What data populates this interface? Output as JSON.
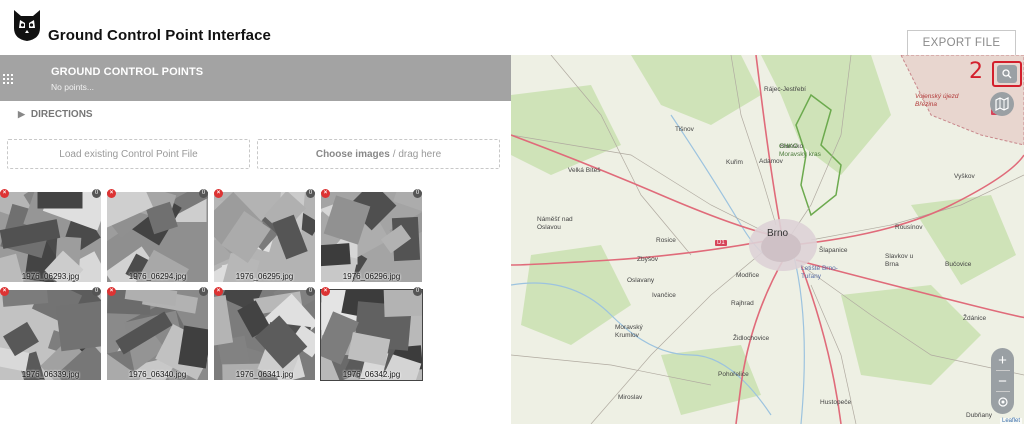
{
  "header": {
    "title": "Ground Control Point Interface",
    "export_label": "EXPORT FILE"
  },
  "gcp_panel": {
    "title": "GROUND CONTROL POINTS",
    "subtitle": "No points..."
  },
  "directions": {
    "label": "DIRECTIONS"
  },
  "actions": {
    "load_label": "Load existing Control Point File",
    "choose_bold": "Choose images",
    "choose_rest": "/ drag here"
  },
  "images": [
    {
      "name": "1976_06293.jpg",
      "points": "0",
      "tone": "#9a9a9a"
    },
    {
      "name": "1976_06294.jpg",
      "points": "0",
      "tone": "#8f8f8f"
    },
    {
      "name": "1976_06295.jpg",
      "points": "0",
      "tone": "#b3b3b3"
    },
    {
      "name": "1976_06296.jpg",
      "points": "0",
      "tone": "#a4a4a4"
    },
    {
      "name": "1976_06339.jpg",
      "points": "0",
      "tone": "#c2c2c2"
    },
    {
      "name": "1976_06340.jpg",
      "points": "0",
      "tone": "#8a8a8a"
    },
    {
      "name": "1976_06341.jpg",
      "points": "0",
      "tone": "#7c7c7c"
    },
    {
      "name": "1976_06342.jpg",
      "points": "0",
      "tone": "#b9b9b9"
    }
  ],
  "map": {
    "annotation": "2",
    "search_icon": "search-icon",
    "layers_icon": "map-icon",
    "zoom_in": "+",
    "zoom_out": "−",
    "attribution": "Leaflet",
    "labels": {
      "rajec": "Rájec-Jestřebí",
      "blansko": "Blansko",
      "tisnov": "Tišnov",
      "kurim": "Kuřim",
      "adamov": "Adamov",
      "chko": "CHKO Moravský kras",
      "vojensky": "Vojenský újezd Březina",
      "d46": "D46",
      "vyskov": "Vyškov",
      "velka_bites": "Velká Bíteš",
      "namest": "Náměšť nad Oslavou",
      "rosice": "Rosice",
      "d1": "D1",
      "brno": "Brno",
      "slapanice": "Šlapanice",
      "rousinov": "Rousínov",
      "letiste": "Letiště Brno-Tuřany",
      "slavkov": "Slavkov u Brna",
      "bucovice": "Bučovice",
      "zbysov": "Zbýšov",
      "modrice": "Modřice",
      "oslavany": "Oslavany",
      "ivancice": "Ivančice",
      "rajhrad": "Rajhrad",
      "zdanice": "Ždánice",
      "moravsky_krumlov": "Moravský Krumlov",
      "zidlochovice": "Židlochovice",
      "pohorelice": "Pohořelice",
      "miroslav": "Miroslav",
      "hustopece": "Hustopeče",
      "dubnany": "Dubňany"
    }
  },
  "colors": {
    "panel_bar": "#a3a3a3",
    "annotation_red": "#d31f2c",
    "map_control": "#9aa0a4"
  }
}
